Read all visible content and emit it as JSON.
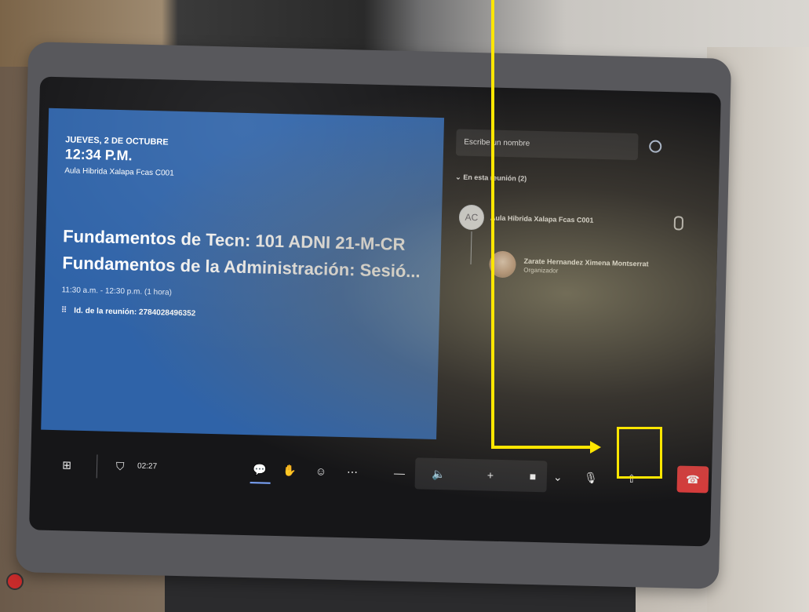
{
  "meeting": {
    "date": "JUEVES, 2 DE OCTUBRE",
    "time": "12:34 P.M.",
    "room": "Aula Hibrida Xalapa Fcas C001",
    "title_line1": "Fundamentos de Tecn: 101 ADNI 21-M-CR",
    "title_line2": "Fundamentos de la Administración: Sesió...",
    "slot": "11:30 a.m. - 12:30 p.m. (1 hora)",
    "meeting_id": "Id. de la reunión: 2784028496352"
  },
  "participants": {
    "search_placeholder": "Escribe un nombre",
    "section_label": "En esta reunión (2)",
    "items": [
      {
        "initials": "AC",
        "name": "Aula Hibrida Xalapa Fcas C001",
        "role": ""
      },
      {
        "initials": "",
        "name": "Zarate Hernandez Ximena Montserrat",
        "role": "Organizador"
      }
    ]
  },
  "toolbar": {
    "timer": "02:27"
  },
  "colors": {
    "meeting_panel": "#2f63a8",
    "annotation": "#ffe600",
    "leave_red": "#d63b3b"
  },
  "icons": [
    "grid-icon",
    "shield-icon",
    "chat-icon",
    "raise-hand-icon",
    "emoji-icon",
    "more-icon",
    "volume-down-icon",
    "speaker-icon",
    "volume-up-icon",
    "camera-icon",
    "chevron-down-icon",
    "mic-icon",
    "share-screen-icon",
    "hang-up-icon"
  ]
}
